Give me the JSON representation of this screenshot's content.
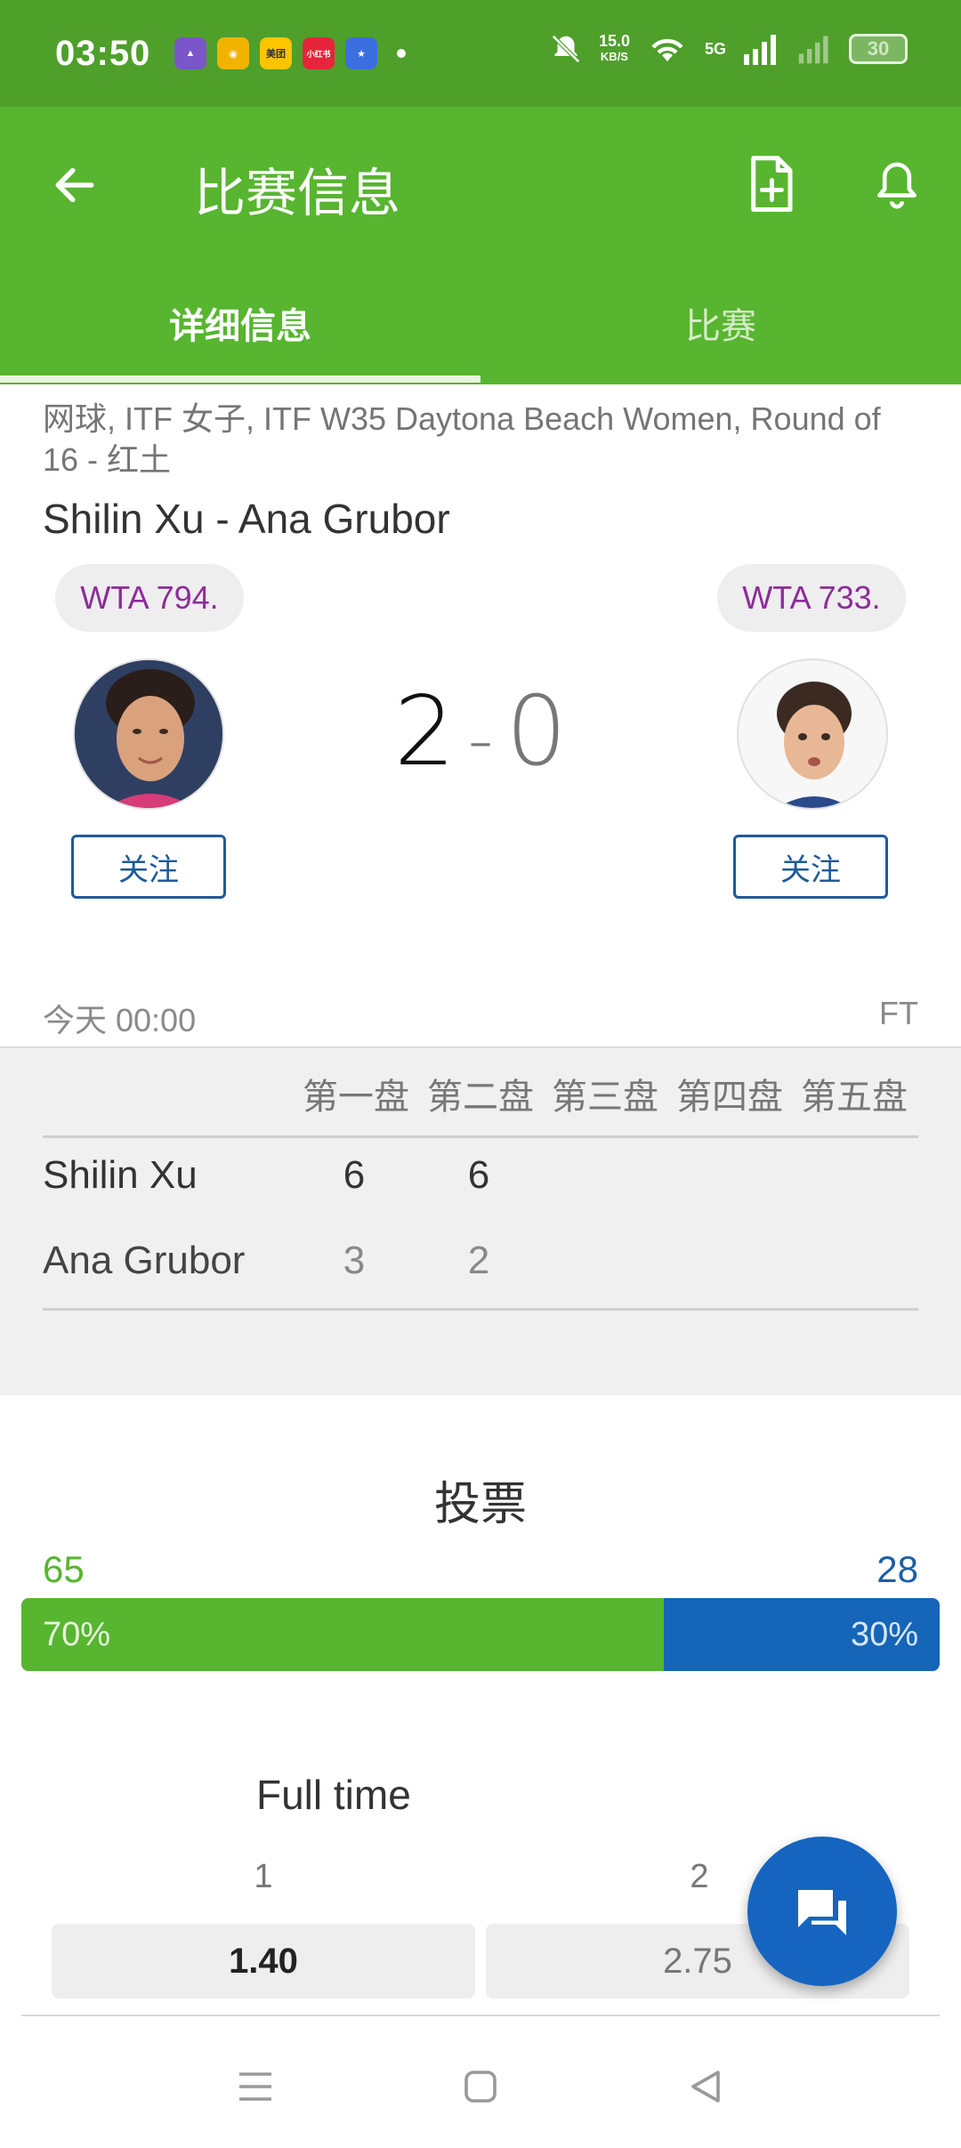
{
  "status_bar": {
    "time": "03:50",
    "apps": [
      {
        "name": "game-app-icon",
        "color": "#7a56c8"
      },
      {
        "name": "weibo-icon",
        "color": "#f0b400"
      },
      {
        "name": "meituan-icon",
        "color": "#ffc400",
        "label": "美团"
      },
      {
        "name": "xiaohongshu-icon",
        "color": "#e8243b",
        "label": "小红书"
      },
      {
        "name": "star-app-icon",
        "color": "#3b6fe0"
      }
    ],
    "net_speed": "15.0",
    "net_speed_unit": "KB/S",
    "network": "5G",
    "battery": "30"
  },
  "header": {
    "title": "比赛信息",
    "tabs": [
      {
        "label": "详细信息",
        "active": true
      },
      {
        "label": "比赛",
        "active": false
      }
    ],
    "colors": {
      "primary": "#57b52f",
      "status": "#4f9f2b"
    }
  },
  "match": {
    "meta": "网球, ITF 女子, ITF W35 Daytona Beach Women, Round of 16 - 红土",
    "title": "Shilin Xu - Ana Grubor",
    "home": {
      "name": "Shilin Xu",
      "rank": "WTA 794.",
      "follow_label": "关注"
    },
    "away": {
      "name": "Ana Grubor",
      "rank": "WTA 733.",
      "follow_label": "关注"
    },
    "score_home": "2",
    "score_sep": "-",
    "score_away": "0",
    "date": "今天 00:00",
    "status": "FT"
  },
  "sets": {
    "headers": [
      "第一盘",
      "第二盘",
      "第三盘",
      "第四盘",
      "第五盘"
    ],
    "rows": [
      {
        "name": "Shilin Xu",
        "scores": [
          "6",
          "6"
        ]
      },
      {
        "name": "Ana Grubor",
        "scores": [
          "3",
          "2"
        ]
      }
    ]
  },
  "vote": {
    "title": "投票",
    "home_count": "65",
    "away_count": "28",
    "home_pct": "70%",
    "away_pct": "30%",
    "home_fraction": 0.7,
    "colors": {
      "home": "#57b52f",
      "away": "#1565b8"
    }
  },
  "odds": {
    "title": "Full time",
    "options": [
      {
        "label": "1",
        "value": "1.40"
      },
      {
        "label": "2",
        "value": "2.75"
      }
    ]
  }
}
